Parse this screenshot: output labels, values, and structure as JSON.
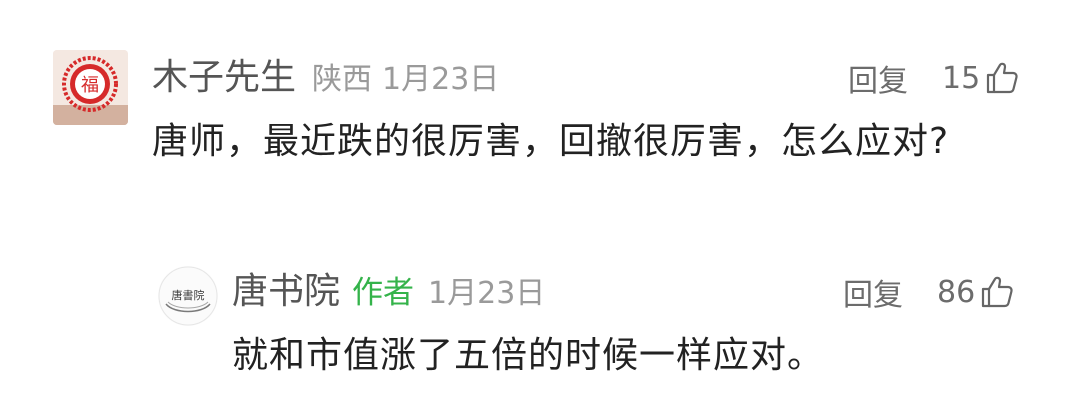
{
  "comment": {
    "username": "木子先生",
    "location": "陕西",
    "date": "1月23日",
    "reply_label": "回复",
    "like_count": "15",
    "text": "唐师，最近跌的很厉害，回撤很厉害，怎么应对?",
    "avatar_glyph": "福"
  },
  "reply": {
    "username": "唐书院",
    "author_badge": "作者",
    "date": "1月23日",
    "reply_label": "回复",
    "like_count": "86",
    "text": "就和市值涨了五倍的时候一样应对。",
    "avatar_label": "唐書院"
  },
  "colors": {
    "author_badge": "#34b34a",
    "avatar_red": "#d62a2a",
    "meta_gray": "#9a9a9a"
  },
  "icons": {
    "like": "thumbs-up-icon"
  }
}
